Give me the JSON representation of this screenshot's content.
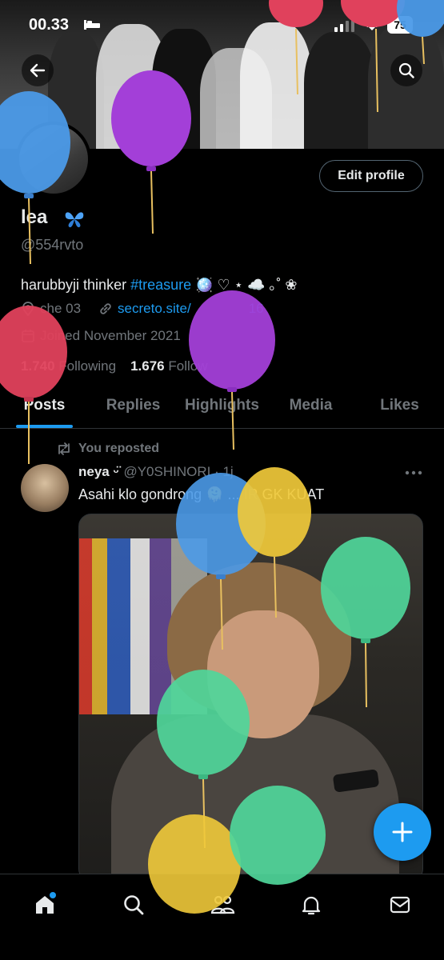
{
  "status_bar": {
    "time": "00.33",
    "battery": "75"
  },
  "profile": {
    "display_name": "lea",
    "handle": "@554rvto",
    "bio_text": "harubbyji thinker ",
    "bio_hashtag": "#treasure",
    "bio_emoji": " 🪩 ♡ ⋆ ☁️ ｡˚ ❀",
    "location": "che 03",
    "link": "secreto.site/",
    "link_suffix": "16",
    "joined": "Joined November 2021",
    "following_count": "1.740",
    "following_label": "Following",
    "followers_count": "1.676",
    "followers_label": "Follow"
  },
  "buttons": {
    "edit_profile": "Edit profile"
  },
  "tabs": [
    {
      "label": "Posts"
    },
    {
      "label": "Replies"
    },
    {
      "label": "Highlights"
    },
    {
      "label": "Media"
    },
    {
      "label": "Likes"
    }
  ],
  "post": {
    "repost_label": "You reposted",
    "author": "neya ᵕ̈",
    "handle": "@Y0SHINORI · 1j",
    "text": "Asahi klo gondrong 🫠 ... IR GK KUAT"
  },
  "icons": {
    "back": "arrow-left-icon",
    "search": "search-icon",
    "sleep": "bed-icon",
    "verified_emoji": "butterfly-icon",
    "location": "location-pin-icon",
    "link": "link-icon",
    "calendar": "calendar-icon",
    "repost": "repost-icon",
    "more": "more-dots-icon",
    "compose": "plus-icon",
    "nav_home": "home-icon",
    "nav_search": "search-icon",
    "nav_communities": "people-icon",
    "nav_notifications": "bell-icon",
    "nav_messages": "mail-icon"
  },
  "colors": {
    "accent": "#1d9bf0",
    "background": "#000000",
    "secondary_text": "#71767b",
    "primary_text": "#e7e9ea"
  }
}
